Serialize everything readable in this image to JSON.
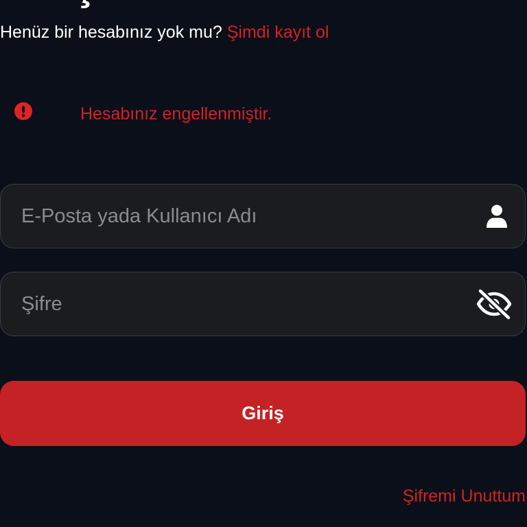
{
  "header": {
    "title_fragment": "Giriş"
  },
  "register": {
    "prompt": "Henüz bir hesabınız yok mu?",
    "link_label": "Şimdi kayıt ol"
  },
  "error": {
    "icon": "exclamation-circle-icon",
    "message": "Hesabınız engellenmiştir."
  },
  "form": {
    "email": {
      "value": "",
      "placeholder": "E-Posta yada Kullanıcı Adı",
      "icon": "user-icon"
    },
    "password": {
      "value": "",
      "placeholder": "Şifre",
      "icon": "eye-slash-icon"
    },
    "submit_label": "Giriş",
    "forgot_label": "Şifremi Unuttum"
  },
  "colors": {
    "background": "#0a0f1a",
    "accent": "#c42224",
    "error": "#d32222",
    "field_background": "#1b1c1f",
    "field_border": "#3a3d44"
  }
}
